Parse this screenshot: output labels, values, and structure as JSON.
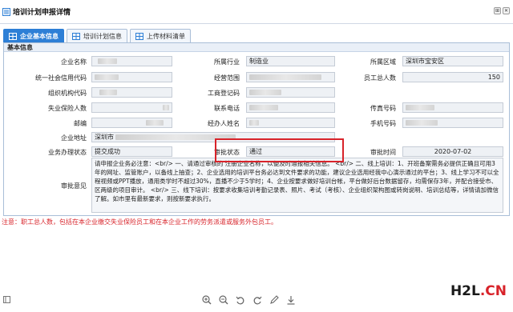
{
  "window": {
    "title": "培训计划申报详情",
    "buttons": [
      "⊞",
      "✕"
    ]
  },
  "tabs": [
    {
      "label": "企业基本信息",
      "active": true
    },
    {
      "label": "培训计划信息",
      "active": false
    },
    {
      "label": "上传材料清单",
      "active": false
    }
  ],
  "section_title": "基本信息",
  "fields": {
    "company_name": {
      "label": "企业名称",
      "value": ""
    },
    "industry": {
      "label": "所属行业",
      "value": "制造业"
    },
    "region": {
      "label": "所属区域",
      "value": "深圳市宝安区"
    },
    "credit_code": {
      "label": "统一社会信用代码",
      "value": ""
    },
    "business_scope": {
      "label": "经营范围",
      "value": ""
    },
    "employee_total": {
      "label": "员工总人数",
      "value": "150"
    },
    "org_code": {
      "label": "组织机构代码",
      "value": ""
    },
    "biz_reg_no": {
      "label": "工商登记码",
      "value": ""
    },
    "insured": {
      "label": "失业保险人数",
      "value": ""
    },
    "contact_phone": {
      "label": "联系电话",
      "value": ""
    },
    "fax": {
      "label": "传真号码",
      "value": ""
    },
    "postcode": {
      "label": "邮编",
      "value": ""
    },
    "handler": {
      "label": "经办人姓名",
      "value": ""
    },
    "mobile": {
      "label": "手机号码",
      "value": ""
    },
    "address": {
      "label": "企业地址",
      "value": "深圳市"
    },
    "status": {
      "label": "业务办理状态",
      "value": "提交成功"
    },
    "approval_status": {
      "label": "审批状态",
      "value": "通过"
    },
    "approval_time": {
      "label": "审批时间",
      "value": "2020-07-02"
    }
  },
  "opinion": {
    "label": "审批意见",
    "text": "请申报企业务必注意：<br/> 一、请通过审核的 注册企业名称，以便及时通报相关信息。 <br/> 二、线上培训：1、开班备案需务必提供正确且可用3年的网址、监管账户，以备线上抽查；2、企业选用的培训平台务必达到文件要求的功能，建议企业选用经我中心演示通过的平台；3、线上学习不可以全程视频或PPT播放，通用类学时不超过30%，直播不少于5学时；4、企业按要求做好培训台帐，平台做好后台数据留存，均需保存3年，并配合接受市、区两级的项目审计。 <br/> 三、线下培训：按要求收集培训考勤记录表、照片、考试（考核）、企业组织架构图或转岗说明、培训总结等，详情请加微信了解。如市里有最新要求，则按新要求执行。"
  },
  "note": "注意：职工总人数，包括在本企业缴交失业保险员工和在本企业工作的劳务派遣或服务外包员工。",
  "toolbar": [
    "zoom-in-icon",
    "zoom-out-icon",
    "undo-icon",
    "redo-icon",
    "pen-icon",
    "download-icon"
  ],
  "watermark": {
    "part1": "H2L",
    "part2": ".CN"
  },
  "colors": {
    "accent": "#2d7fd6",
    "highlight": "#d8232a"
  }
}
